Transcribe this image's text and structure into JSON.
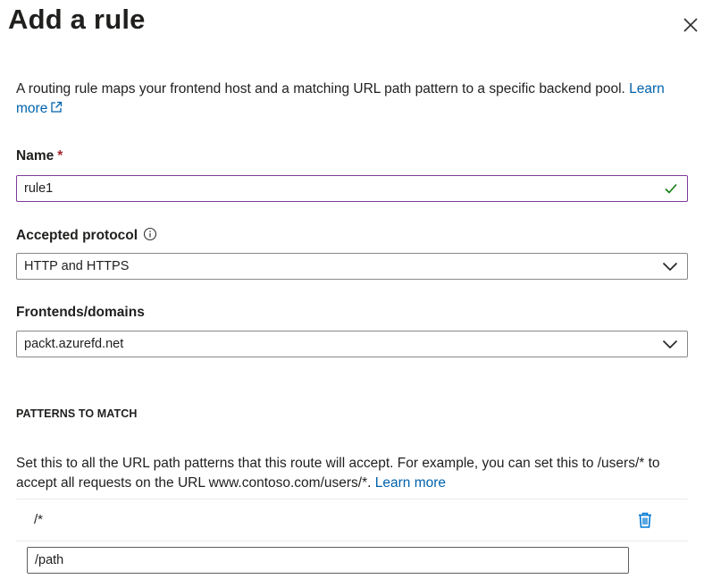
{
  "panel": {
    "title": "Add a rule",
    "close_icon": "close-icon"
  },
  "description": {
    "text": "A routing rule maps your frontend host and a matching URL path pattern to a specific backend pool.",
    "link_text": "Learn more"
  },
  "fields": {
    "name": {
      "label": "Name",
      "required_marker": "*",
      "value": "rule1",
      "valid": true
    },
    "protocol": {
      "label": "Accepted protocol",
      "value": "HTTP and HTTPS"
    },
    "frontends": {
      "label": "Frontends/domains",
      "value": "packt.azurefd.net"
    }
  },
  "patterns": {
    "section_title": "PATTERNS TO MATCH",
    "help_text": "Set this to all the URL path patterns that this route will accept. For example, you can set this to /users/* to accept all requests on the URL www.contoso.com/users/*.",
    "help_link": "Learn more",
    "rows": [
      {
        "pattern": "/*"
      }
    ],
    "new_pattern_value": "/path"
  },
  "colors": {
    "link": "#0062ad",
    "required": "#a4262c",
    "valid_border": "#7e3b96",
    "check": "#107c10"
  }
}
